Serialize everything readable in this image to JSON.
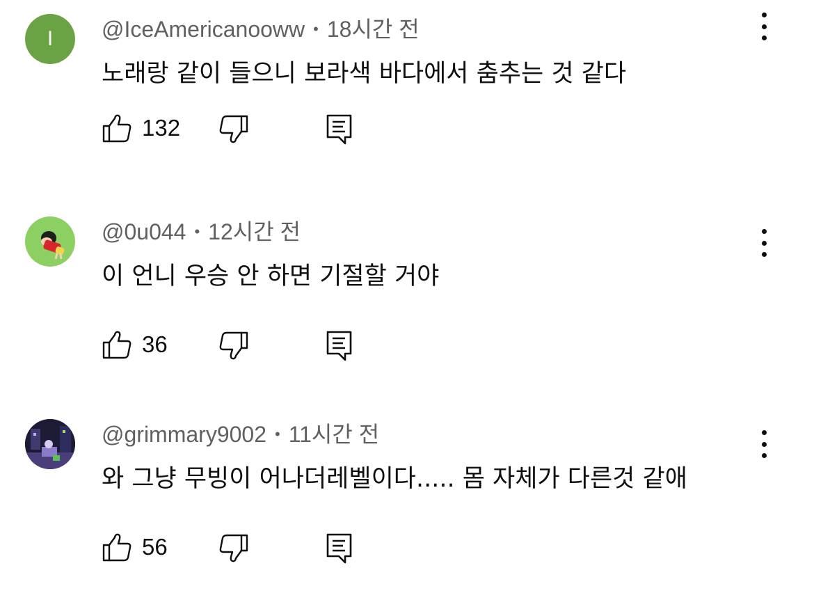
{
  "comments": [
    {
      "handle": "@IceAmericanooww",
      "time": "18시간 전",
      "text": "노래랑 같이 들으니 보라색 바다에서 춤추는 것 같다",
      "likes": "132",
      "avatar_letter": "I",
      "avatar_color": "#6aa343"
    },
    {
      "handle": "@0u044",
      "time": "12시간 전",
      "text": "이 언니 우승 안 하면 기절할 거야",
      "likes": "36"
    },
    {
      "handle": "@grimmary9002",
      "time": "11시간 전",
      "text": "와 그냥 무빙이 어나더레벨이다..... 몸 자체가 다른것 같애",
      "likes": "56"
    }
  ],
  "separator": "•",
  "icons": {
    "like": "thumbs-up-icon",
    "dislike": "thumbs-down-icon",
    "reply": "reply-icon",
    "more": "more-vertical-icon"
  }
}
